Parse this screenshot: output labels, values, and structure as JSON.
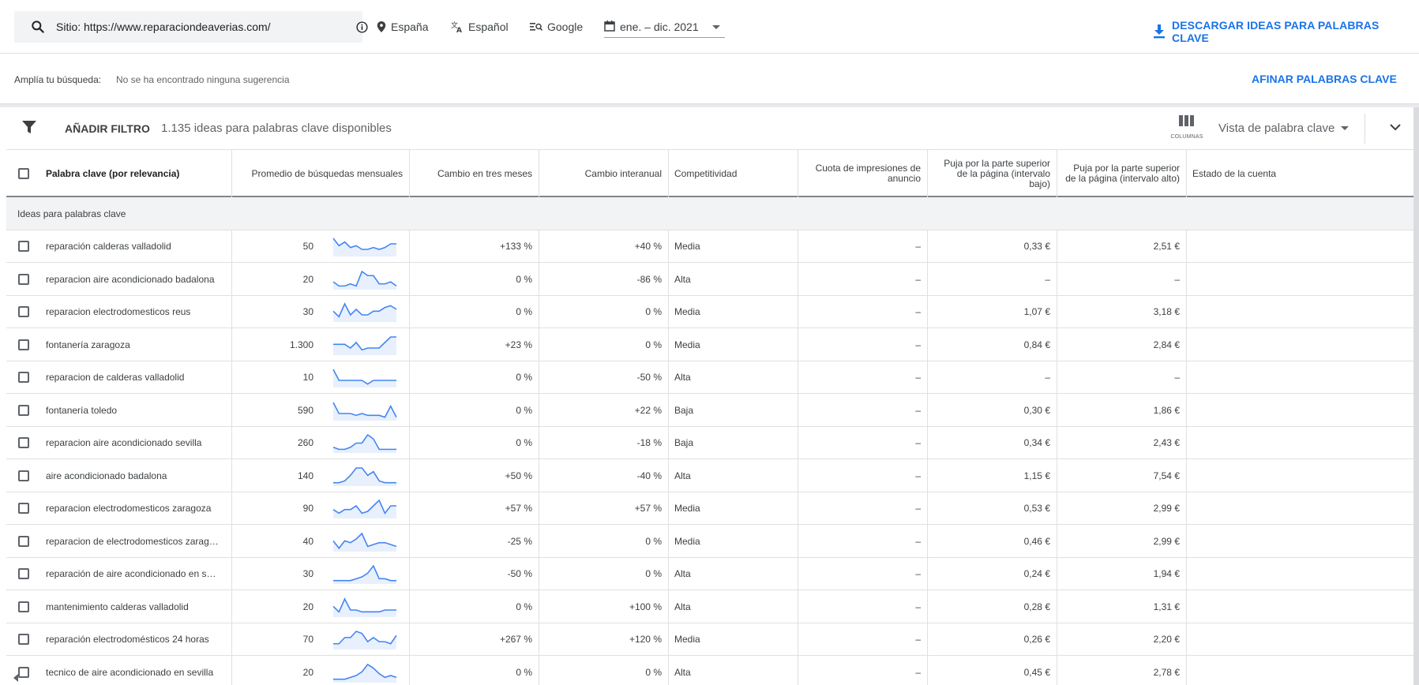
{
  "search": {
    "value": "Sitio: https://www.reparaciondeaverias.com/"
  },
  "filters": {
    "location": "España",
    "language": "Español",
    "network": "Google",
    "date_range": "ene. – dic. 2021"
  },
  "download_label": "DESCARGAR IDEAS PARA PALABRAS CLAVE",
  "suggestions": {
    "label": "Amplía tu búsqueda:",
    "text": "No se ha encontrado ninguna sugerencia",
    "refine_label": "AFINAR PALABRAS CLAVE"
  },
  "toolbar": {
    "add_filter": "AÑADIR FILTRO",
    "count_text": "1.135 ideas para palabras clave disponibles",
    "columns_label": "COLUMNAS",
    "view_label": "Vista de palabra clave"
  },
  "columns": {
    "keyword": "Palabra clave (por relevancia)",
    "avg": "Promedio de búsquedas mensuales",
    "three_month": "Cambio en tres meses",
    "yoy": "Cambio interanual",
    "competition": "Competitividad",
    "impr_share": "Cuota de impresiones de anuncio",
    "bid_low": "Puja por la parte superior de la página (intervalo bajo)",
    "bid_high": "Puja por la parte superior de la página (intervalo alto)",
    "status": "Estado de la cuenta"
  },
  "group_label": "Ideas para palabras clave",
  "rows": [
    {
      "keyword": "reparación calderas valladolid",
      "avg": "50",
      "three_month": "+133 %",
      "yoy": "+40 %",
      "competition": "Media",
      "impr_share": "–",
      "bid_low": "0,33 €",
      "bid_high": "2,51 €",
      "trend": [
        9,
        5,
        7,
        4,
        5,
        3,
        3,
        4,
        3,
        4,
        6,
        6
      ]
    },
    {
      "keyword": "reparacion aire acondicionado badalona",
      "avg": "20",
      "three_month": "0 %",
      "yoy": "-86 %",
      "competition": "Alta",
      "impr_share": "–",
      "bid_low": "–",
      "bid_high": "–",
      "trend": [
        3,
        1,
        1,
        2,
        1,
        8,
        6,
        6,
        2,
        2,
        3,
        1
      ]
    },
    {
      "keyword": "reparacion electrodomesticos reus",
      "avg": "30",
      "three_month": "0 %",
      "yoy": "0 %",
      "competition": "Media",
      "impr_share": "–",
      "bid_low": "1,07 €",
      "bid_high": "3,18 €",
      "trend": [
        5,
        2,
        9,
        3,
        6,
        3,
        3,
        5,
        5,
        7,
        8,
        6
      ]
    },
    {
      "keyword": "fontanería zaragoza",
      "avg": "1.300",
      "three_month": "+23 %",
      "yoy": "0 %",
      "competition": "Media",
      "impr_share": "–",
      "bid_low": "0,84 €",
      "bid_high": "2,84 €",
      "trend": [
        5,
        5,
        5,
        3,
        6,
        2,
        3,
        3,
        3,
        6,
        9,
        9
      ]
    },
    {
      "keyword": "reparacion de calderas valladolid",
      "avg": "10",
      "three_month": "0 %",
      "yoy": "-50 %",
      "competition": "Alta",
      "impr_share": "–",
      "bid_low": "–",
      "bid_high": "–",
      "trend": [
        9,
        3,
        3,
        3,
        3,
        3,
        1,
        3,
        3,
        3,
        3,
        3
      ]
    },
    {
      "keyword": "fontanería toledo",
      "avg": "590",
      "three_month": "0 %",
      "yoy": "+22 %",
      "competition": "Baja",
      "impr_share": "–",
      "bid_low": "0,30 €",
      "bid_high": "1,86 €",
      "trend": [
        9,
        3,
        3,
        3,
        2,
        3,
        2,
        2,
        2,
        1,
        7,
        1
      ]
    },
    {
      "keyword": "reparacion aire acondicionado sevilla",
      "avg": "260",
      "three_month": "0 %",
      "yoy": "-18 %",
      "competition": "Baja",
      "impr_share": "–",
      "bid_low": "0,34 €",
      "bid_high": "2,43 €",
      "trend": [
        2,
        1,
        1,
        2,
        4,
        4,
        8,
        6,
        1,
        1,
        1,
        1
      ]
    },
    {
      "keyword": "aire acondicionado badalona",
      "avg": "140",
      "three_month": "+50 %",
      "yoy": "-40 %",
      "competition": "Alta",
      "impr_share": "–",
      "bid_low": "1,15 €",
      "bid_high": "7,54 €",
      "trend": [
        1,
        1,
        2,
        5,
        9,
        9,
        5,
        7,
        2,
        1,
        1,
        1
      ]
    },
    {
      "keyword": "reparacion electrodomesticos zaragoza",
      "avg": "90",
      "three_month": "+57 %",
      "yoy": "+57 %",
      "competition": "Media",
      "impr_share": "–",
      "bid_low": "0,53 €",
      "bid_high": "2,99 €",
      "trend": [
        4,
        2,
        4,
        4,
        6,
        2,
        3,
        6,
        9,
        2,
        6,
        6
      ]
    },
    {
      "keyword": "reparacion de electrodomesticos zarag…",
      "avg": "40",
      "three_month": "-25 %",
      "yoy": "0 %",
      "competition": "Media",
      "impr_share": "–",
      "bid_low": "0,46 €",
      "bid_high": "2,99 €",
      "trend": [
        5,
        1,
        5,
        4,
        6,
        9,
        2,
        3,
        4,
        4,
        3,
        2
      ]
    },
    {
      "keyword": "reparación de aire acondicionado en s…",
      "avg": "30",
      "three_month": "-50 %",
      "yoy": "0 %",
      "competition": "Alta",
      "impr_share": "–",
      "bid_low": "0,24 €",
      "bid_high": "1,94 €",
      "trend": [
        1,
        1,
        1,
        1,
        2,
        3,
        5,
        9,
        2,
        2,
        1,
        1
      ]
    },
    {
      "keyword": "mantenimiento calderas valladolid",
      "avg": "20",
      "three_month": "0 %",
      "yoy": "+100 %",
      "competition": "Alta",
      "impr_share": "–",
      "bid_low": "0,28 €",
      "bid_high": "1,31 €",
      "trend": [
        5,
        2,
        9,
        3,
        3,
        2,
        2,
        2,
        2,
        3,
        3,
        3
      ]
    },
    {
      "keyword": "reparación electrodomésticos 24 horas",
      "avg": "70",
      "three_month": "+267 %",
      "yoy": "+120 %",
      "competition": "Media",
      "impr_share": "–",
      "bid_low": "0,26 €",
      "bid_high": "2,20 €",
      "trend": [
        2,
        2,
        5,
        5,
        8,
        7,
        3,
        5,
        3,
        3,
        2,
        6
      ]
    },
    {
      "keyword": "tecnico de aire acondicionado en sevilla",
      "avg": "20",
      "three_month": "0 %",
      "yoy": "0 %",
      "competition": "Alta",
      "impr_share": "–",
      "bid_low": "0,45 €",
      "bid_high": "2,78 €",
      "trend": [
        1,
        1,
        1,
        2,
        3,
        5,
        9,
        7,
        4,
        2,
        3,
        2
      ]
    }
  ],
  "colors": {
    "accent": "#1a73e8",
    "spark_line": "#4285f4",
    "spark_fill": "#e8f0fe"
  }
}
